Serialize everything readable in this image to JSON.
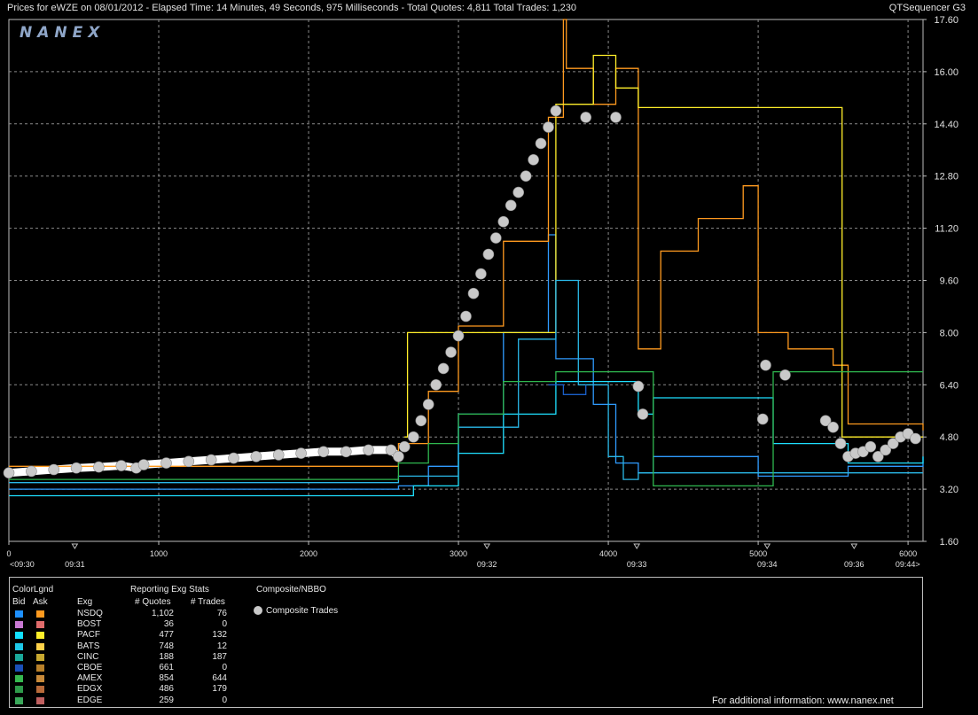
{
  "header": {
    "title_left": "Prices for  eWZE  on  08/01/2012  -  Elapsed Time: 14 Minutes, 49 Seconds, 975 Milliseconds  -  Total Quotes: 4,811  Total Trades: 1,230",
    "title_right": "QTSequencer G3"
  },
  "watermark": "NANEX",
  "colors": {
    "background": "#000000",
    "grid": "#8a8a8a",
    "axis": "#bdbdbd",
    "composite_trade": "#c9c9c9",
    "nbbo_bid_band": "#ffffff"
  },
  "chart_data": {
    "type": "line",
    "x_axis": {
      "min": 0,
      "max": 6100,
      "ticks": [
        "0",
        "1000",
        "2000",
        "3000",
        "4000",
        "5000",
        "6000"
      ],
      "tick_values": [
        0,
        1000,
        2000,
        3000,
        4000,
        5000,
        6000
      ],
      "time_labels": [
        "<09:30",
        "09:31",
        "09:32",
        "09:33",
        "09:34",
        "09:36",
        "09:44>"
      ],
      "time_label_at": [
        0,
        440,
        3190,
        4190,
        5060,
        5640,
        6080
      ]
    },
    "y_axis": {
      "min": 1.6,
      "max": 17.6,
      "ticks": [
        "17.60",
        "16.00",
        "14.40",
        "12.80",
        "11.20",
        "9.60",
        "8.00",
        "6.40",
        "4.80",
        "3.20",
        "1.60"
      ],
      "tick_values": [
        17.6,
        16.0,
        14.4,
        12.8,
        11.2,
        9.6,
        8.0,
        6.4,
        4.8,
        3.2,
        1.6
      ]
    },
    "grid": true,
    "series": [
      {
        "name": "Composite Trades",
        "kind": "scatter",
        "color": "#c9c9c9",
        "points": [
          [
            0,
            3.7
          ],
          [
            150,
            3.75
          ],
          [
            300,
            3.8
          ],
          [
            450,
            3.85
          ],
          [
            600,
            3.88
          ],
          [
            750,
            3.92
          ],
          [
            850,
            3.85
          ],
          [
            900,
            3.95
          ],
          [
            1050,
            4.0
          ],
          [
            1200,
            4.05
          ],
          [
            1350,
            4.1
          ],
          [
            1500,
            4.15
          ],
          [
            1650,
            4.2
          ],
          [
            1800,
            4.25
          ],
          [
            1950,
            4.3
          ],
          [
            2100,
            4.35
          ],
          [
            2250,
            4.35
          ],
          [
            2400,
            4.4
          ],
          [
            2550,
            4.4
          ],
          [
            2600,
            4.2
          ],
          [
            2640,
            4.5
          ],
          [
            2700,
            4.8
          ],
          [
            2750,
            5.3
          ],
          [
            2800,
            5.8
          ],
          [
            2850,
            6.4
          ],
          [
            2900,
            6.9
          ],
          [
            2950,
            7.4
          ],
          [
            3000,
            7.9
          ],
          [
            3050,
            8.5
          ],
          [
            3100,
            9.2
          ],
          [
            3150,
            9.8
          ],
          [
            3200,
            10.4
          ],
          [
            3250,
            10.9
          ],
          [
            3300,
            11.4
          ],
          [
            3350,
            11.9
          ],
          [
            3400,
            12.3
          ],
          [
            3450,
            12.8
          ],
          [
            3500,
            13.3
          ],
          [
            3550,
            13.8
          ],
          [
            3600,
            14.3
          ],
          [
            3650,
            14.8
          ],
          [
            3850,
            14.6
          ],
          [
            4050,
            14.6
          ],
          [
            4200,
            6.35
          ],
          [
            4230,
            5.5
          ],
          [
            5030,
            5.35
          ],
          [
            5050,
            7.0
          ],
          [
            5180,
            6.7
          ],
          [
            5450,
            5.3
          ],
          [
            5500,
            5.1
          ],
          [
            5550,
            4.6
          ],
          [
            5600,
            4.2
          ],
          [
            5650,
            4.3
          ],
          [
            5700,
            4.35
          ],
          [
            5750,
            4.5
          ],
          [
            5800,
            4.2
          ],
          [
            5850,
            4.4
          ],
          [
            5900,
            4.6
          ],
          [
            5950,
            4.8
          ],
          [
            6000,
            4.9
          ],
          [
            6050,
            4.75
          ]
        ]
      },
      {
        "name": "NSDQ Bid",
        "kind": "line",
        "color": "#2f9bff",
        "points": [
          [
            0,
            3.2
          ],
          [
            2600,
            3.3
          ],
          [
            2800,
            3.9
          ],
          [
            3000,
            5.5
          ],
          [
            3300,
            8.0
          ],
          [
            3600,
            11.0
          ],
          [
            3650,
            7.2
          ],
          [
            3900,
            5.8
          ],
          [
            4050,
            4.0
          ],
          [
            4200,
            3.7
          ],
          [
            4300,
            4.2
          ],
          [
            4600,
            4.2
          ],
          [
            4900,
            4.2
          ],
          [
            5000,
            3.6
          ],
          [
            5600,
            3.9
          ],
          [
            6100,
            4.2
          ]
        ]
      },
      {
        "name": "NSDQ Ask",
        "kind": "line",
        "color": "#ff9a1f",
        "points": [
          [
            0,
            3.9
          ],
          [
            2600,
            4.6
          ],
          [
            2800,
            6.2
          ],
          [
            3000,
            8.2
          ],
          [
            3300,
            10.8
          ],
          [
            3600,
            14.6
          ],
          [
            3700,
            17.6
          ],
          [
            3720,
            16.1
          ],
          [
            3900,
            15.0
          ],
          [
            4050,
            16.1
          ],
          [
            4200,
            7.5
          ],
          [
            4350,
            10.5
          ],
          [
            4600,
            11.5
          ],
          [
            4900,
            12.5
          ],
          [
            5000,
            8.0
          ],
          [
            5200,
            7.5
          ],
          [
            5500,
            7.0
          ],
          [
            5600,
            5.2
          ],
          [
            6100,
            5.0
          ]
        ]
      },
      {
        "name": "PACF Bid",
        "kind": "line",
        "color": "#1ee0ff",
        "points": [
          [
            0,
            3.0
          ],
          [
            2500,
            3.0
          ],
          [
            2700,
            3.3
          ],
          [
            3000,
            4.3
          ],
          [
            3300,
            5.5
          ],
          [
            3650,
            6.5
          ],
          [
            4200,
            5.5
          ],
          [
            4300,
            6.0
          ],
          [
            5000,
            6.0
          ],
          [
            5100,
            4.6
          ],
          [
            5500,
            4.6
          ],
          [
            5600,
            4.0
          ],
          [
            6100,
            4.2
          ]
        ]
      },
      {
        "name": "PACF Ask",
        "kind": "line",
        "color": "#ffee2a",
        "points": [
          [
            2640,
            4.8
          ],
          [
            2660,
            8.0
          ],
          [
            3000,
            8.0
          ],
          [
            3650,
            15.0
          ],
          [
            3900,
            16.5
          ],
          [
            4050,
            15.5
          ],
          [
            4200,
            14.9
          ],
          [
            5550,
            14.9
          ],
          [
            5560,
            4.8
          ],
          [
            6100,
            4.8
          ]
        ]
      },
      {
        "name": "BATS Bid",
        "kind": "line",
        "color": "#2ab8e8",
        "points": [
          [
            0,
            3.4
          ],
          [
            2600,
            3.6
          ],
          [
            3000,
            5.1
          ],
          [
            3400,
            7.8
          ],
          [
            3650,
            9.6
          ],
          [
            3800,
            6.4
          ],
          [
            4000,
            4.2
          ],
          [
            4100,
            3.5
          ],
          [
            4200,
            3.7
          ],
          [
            6100,
            3.7
          ]
        ]
      },
      {
        "name": "AMEX Bid",
        "kind": "line",
        "color": "#2fb84f",
        "points": [
          [
            0,
            3.5
          ],
          [
            2600,
            4.0
          ],
          [
            2800,
            4.6
          ],
          [
            3000,
            5.5
          ],
          [
            3300,
            6.5
          ],
          [
            3650,
            6.8
          ],
          [
            4200,
            6.8
          ],
          [
            4300,
            3.3
          ],
          [
            5000,
            3.3
          ],
          [
            5100,
            6.8
          ],
          [
            6100,
            6.8
          ]
        ]
      },
      {
        "name": "CBOE Bid",
        "kind": "line",
        "color": "#1a5fc8",
        "points": [
          [
            3600,
            6.4
          ],
          [
            3650,
            6.4
          ],
          [
            3700,
            6.1
          ],
          [
            3800,
            6.1
          ],
          [
            3850,
            6.4
          ]
        ]
      }
    ]
  },
  "legend": {
    "header_colorlgnd": "ColorLgnd",
    "header_bid": "Bid",
    "header_ask": "Ask",
    "header_exg": "Exg",
    "header_stats": "Reporting Exg Stats",
    "header_quotes": "# Quotes",
    "header_trades": "# Trades",
    "header_composite": "Composite/NBBO",
    "composite_trades_label": "Composite Trades",
    "rows": [
      {
        "exg": "NSDQ",
        "quotes": "1,102",
        "trades": "76",
        "bid_color": "#1e90ff",
        "ask_color": "#ff9a1f"
      },
      {
        "exg": "BOST",
        "quotes": "36",
        "trades": "0",
        "bid_color": "#c878d2",
        "ask_color": "#e06b6b"
      },
      {
        "exg": "PACF",
        "quotes": "477",
        "trades": "132",
        "bid_color": "#12e0ff",
        "ask_color": "#ffee2a"
      },
      {
        "exg": "BATS",
        "quotes": "748",
        "trades": "12",
        "bid_color": "#1ec8e8",
        "ask_color": "#ffd24a"
      },
      {
        "exg": "CINC",
        "quotes": "188",
        "trades": "187",
        "bid_color": "#1aa89a",
        "ask_color": "#c8a830"
      },
      {
        "exg": "CBOE",
        "quotes": "661",
        "trades": "0",
        "bid_color": "#1a4fb8",
        "ask_color": "#b8802a"
      },
      {
        "exg": "AMEX",
        "quotes": "854",
        "trades": "644",
        "bid_color": "#36b84f",
        "ask_color": "#c88a3a"
      },
      {
        "exg": "EDGX",
        "quotes": "486",
        "trades": "179",
        "bid_color": "#2e9a4a",
        "ask_color": "#b86a3a"
      },
      {
        "exg": "EDGE",
        "quotes": "259",
        "trades": "0",
        "bid_color": "#3aa85a",
        "ask_color": "#c06060"
      }
    ],
    "footer": "For additional information: www.nanex.net"
  }
}
